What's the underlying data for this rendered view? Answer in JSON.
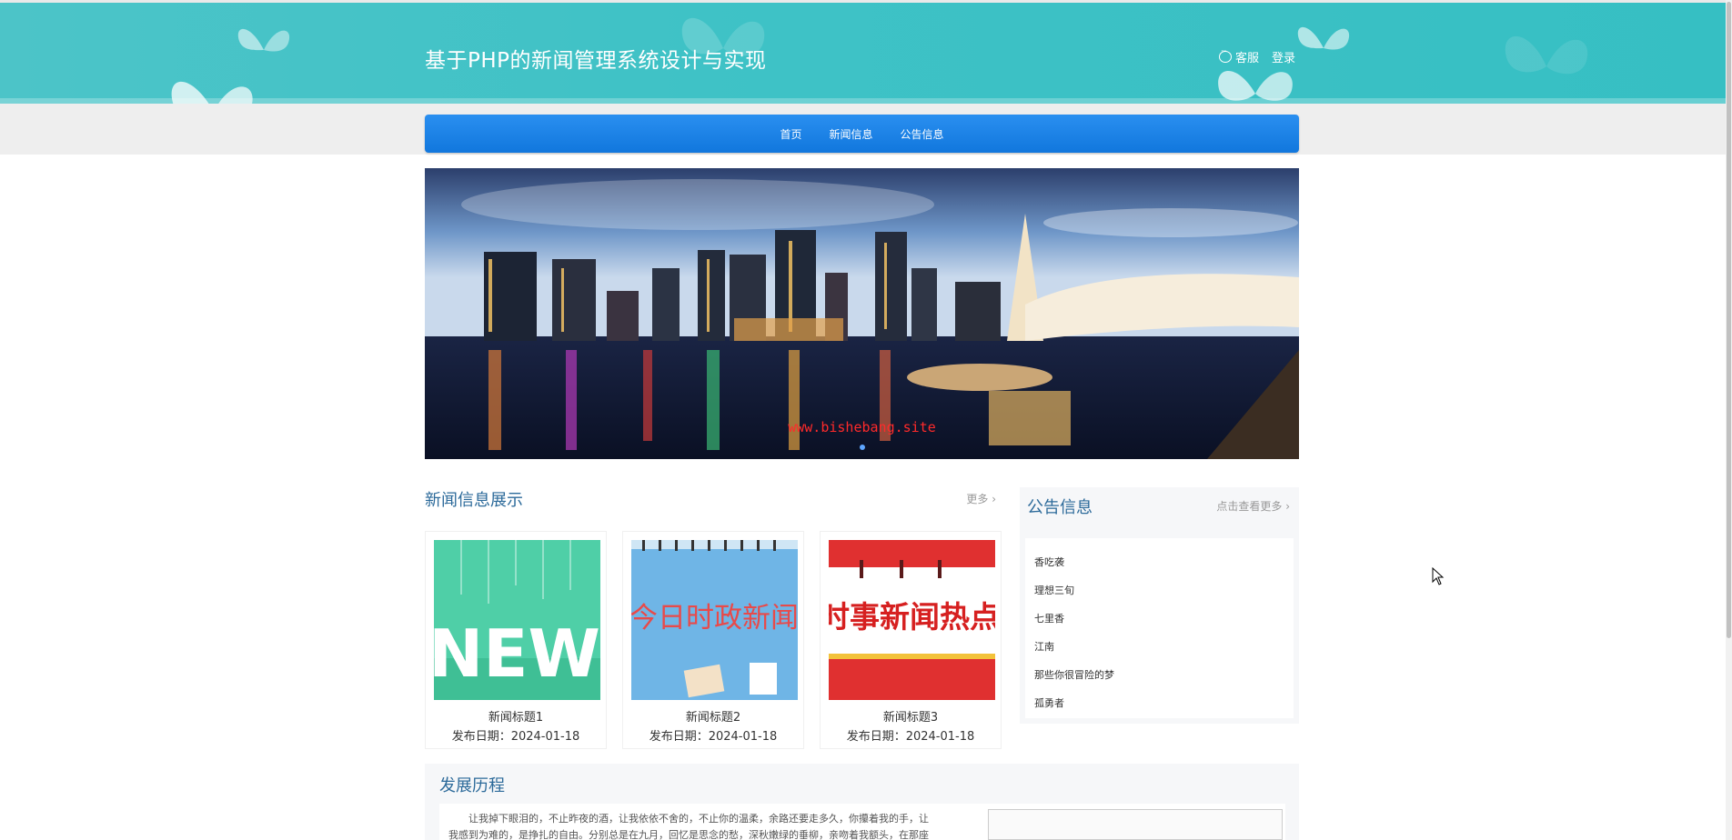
{
  "header": {
    "title": "基于PHP的新闻管理系统设计与实现",
    "service_label": "客服",
    "login_label": "登录"
  },
  "nav": {
    "items": [
      {
        "label": "首页"
      },
      {
        "label": "新闻信息"
      },
      {
        "label": "公告信息"
      }
    ]
  },
  "banner": {
    "watermark": "www.bishebang.site"
  },
  "news": {
    "title": "新闻信息展示",
    "more_label": "更多 ›",
    "cards": [
      {
        "title": "新闻标题1",
        "date": "发布日期：2024-01-18",
        "image_text": "NEWS"
      },
      {
        "title": "新闻标题2",
        "date": "发布日期：2024-01-18",
        "image_text": "今日时政新闻"
      },
      {
        "title": "新闻标题3",
        "date": "发布日期：2024-01-18",
        "image_text": "时事新闻热点"
      }
    ]
  },
  "notice": {
    "title": "公告信息",
    "more_label": "点击查看更多 ›",
    "items": [
      {
        "label": "香吃袭"
      },
      {
        "label": "理想三旬"
      },
      {
        "label": "七里香"
      },
      {
        "label": "江南"
      },
      {
        "label": "那些你很冒险的梦"
      },
      {
        "label": "孤勇者"
      }
    ]
  },
  "history": {
    "title": "发展历程",
    "text": "让我掉下眼泪的，不止昨夜的酒，让我依依不舍的，不止你的温柔，余路还要走多久，你攥着我的手，让我感到为难的，是挣扎的自由。分别总是在九月，回忆是思念的愁，深秋嫩绿的垂柳，亲吻着我额头，在那座阴雨的小城里"
  },
  "colors": {
    "header_bg": "#3fc2c6",
    "nav_bg": "#1a82e6",
    "section_title": "#2c6a9a"
  }
}
